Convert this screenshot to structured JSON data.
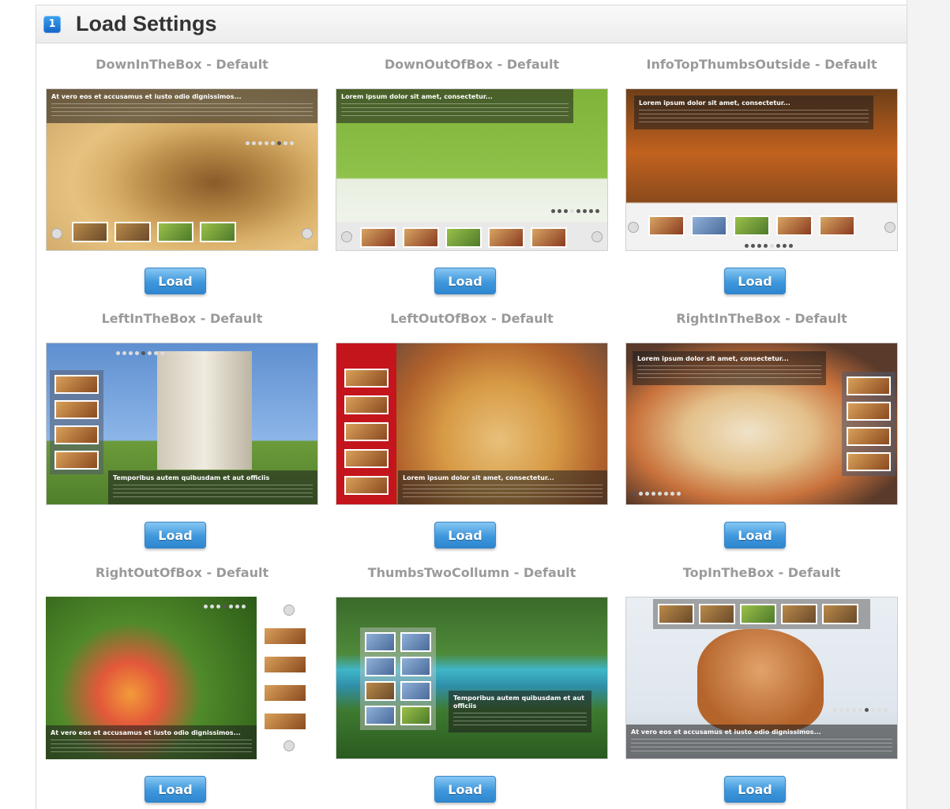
{
  "panel": {
    "step_number": "1",
    "title": "Load Settings"
  },
  "presets": [
    {
      "title": "DownInTheBox - Default",
      "load_label": "Load",
      "caption": "At vero eos et accusamus et iusto odio dignissimos..."
    },
    {
      "title": "DownOutOfBox - Default",
      "load_label": "Load",
      "caption": "Lorem ipsum dolor sit amet, consectetur..."
    },
    {
      "title": "InfoTopThumbsOutside - Default",
      "load_label": "Load",
      "caption": "Lorem ipsum dolor sit amet, consectetur..."
    },
    {
      "title": "LeftInTheBox - Default",
      "load_label": "Load",
      "caption": "Temporibus autem quibusdam et aut officiis"
    },
    {
      "title": "LeftOutOfBox - Default",
      "load_label": "Load",
      "caption": "Lorem ipsum dolor sit amet, consectetur..."
    },
    {
      "title": "RightInTheBox - Default",
      "load_label": "Load",
      "caption": "Lorem ipsum dolor sit amet, consectetur..."
    },
    {
      "title": "RightOutOfBox - Default",
      "load_label": "Load",
      "caption": "At vero eos et accusamus et iusto odio dignissimos..."
    },
    {
      "title": "ThumbsTwoCollumn - Default",
      "load_label": "Load",
      "caption": "Temporibus autem quibusdam et aut officiis"
    },
    {
      "title": "TopInTheBox - Default",
      "load_label": "Load",
      "caption": "At vero eos et accusamus et iusto odio dignissimos..."
    }
  ],
  "colors": {
    "accent": "#2e86d0",
    "title_gray": "#9a9a9a"
  }
}
